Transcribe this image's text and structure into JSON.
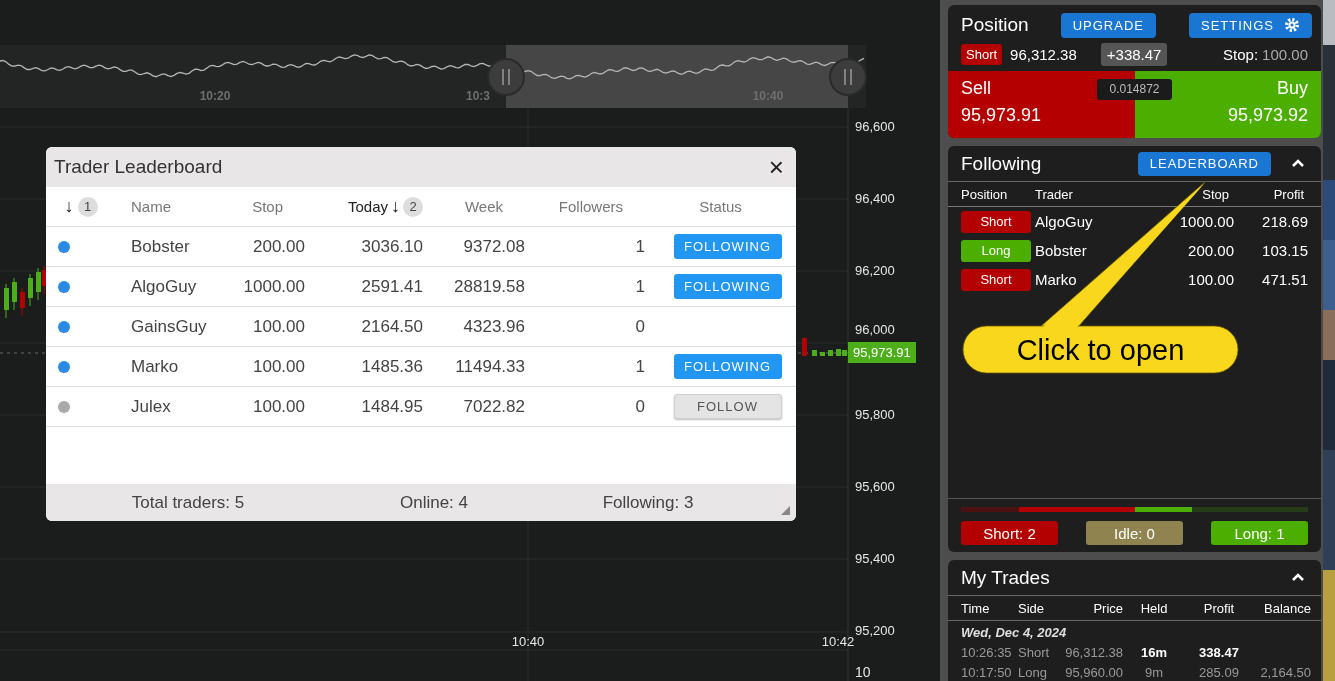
{
  "chart": {
    "navigator": {
      "time_labels": [
        "10:20",
        "10:3",
        "10:40"
      ]
    },
    "price_labels": [
      "96,600",
      "96,400",
      "96,200",
      "96,000",
      "95,800",
      "95,600",
      "95,400",
      "95,200",
      "10"
    ],
    "time_labels": [
      "10:40",
      "10:42"
    ],
    "current_price": "95,973.91"
  },
  "leaderboard": {
    "title": "Trader Leaderboard",
    "close": "×",
    "columns": [
      {
        "kind": "sort",
        "arrow": "↓",
        "badge": "1"
      },
      {
        "kind": "text",
        "label": "Name"
      },
      {
        "kind": "text",
        "label": "Stop"
      },
      {
        "kind": "sorted",
        "label": "Today",
        "arrow": "↓",
        "badge": "2"
      },
      {
        "kind": "text",
        "label": "Week"
      },
      {
        "kind": "text",
        "label": "Followers"
      },
      {
        "kind": "text",
        "label": "Status"
      }
    ],
    "rows": [
      {
        "color": "#2a8ae6",
        "name": "Bobster",
        "stop": "200.00",
        "today": "3036.10",
        "week": "9372.08",
        "followers": "1",
        "status": {
          "kind": "following",
          "label": "FOLLOWING"
        }
      },
      {
        "color": "#2a8ae6",
        "name": "AlgoGuy",
        "stop": "1000.00",
        "today": "2591.41",
        "week": "28819.58",
        "followers": "1",
        "status": {
          "kind": "following",
          "label": "FOLLOWING"
        }
      },
      {
        "color": "#2a8ae6",
        "name": "GainsGuy",
        "stop": "100.00",
        "today": "2164.50",
        "week": "4323.96",
        "followers": "0"
      },
      {
        "color": "#2a8ae6",
        "name": "Marko",
        "stop": "100.00",
        "today": "1485.36",
        "week": "11494.33",
        "followers": "1",
        "status": {
          "kind": "following",
          "label": "FOLLOWING"
        }
      },
      {
        "color": "#aaaaaa",
        "name": "Julex",
        "stop": "100.00",
        "today": "1484.95",
        "week": "7022.82",
        "followers": "0",
        "status": {
          "kind": "follow",
          "label": "FOLLOW"
        }
      }
    ],
    "footer": [
      "Total traders: 5",
      "Online: 4",
      "Following: 3"
    ]
  },
  "position": {
    "title": "Position",
    "buttons": [
      {
        "kind": "plain",
        "label": "UPGRADE"
      },
      {
        "kind": "settings",
        "label": "SETTINGS"
      }
    ],
    "side": {
      "kind": "short",
      "label": "Short"
    },
    "entry": "96,312.38",
    "pnl": "+338.47",
    "stop_label": "Stop:",
    "stop_value": "100.00",
    "sell": {
      "label": "Sell",
      "price": "95,973.91"
    },
    "spread": "0.014872",
    "buy": {
      "label": "Buy",
      "price": "95,973.92"
    }
  },
  "following": {
    "title": "Following",
    "button": "LEADERBOARD",
    "expanded": true,
    "columns": [
      "Position",
      "Trader",
      "Stop",
      "Profit"
    ],
    "rows": [
      {
        "kind": "short",
        "side": "Short",
        "trader": "AlgoGuy",
        "stop": "1000.00",
        "profit": "218.69"
      },
      {
        "kind": "long",
        "side": "Long",
        "trader": "Bobster",
        "stop": "200.00",
        "profit": "103.15"
      },
      {
        "kind": "short",
        "side": "Short",
        "trader": "Marko",
        "stop": "100.00",
        "profit": "471.51"
      }
    ],
    "bar": {
      "short": {
        "level": 0.667
      },
      "long": {
        "level": 0.333
      }
    },
    "counts": [
      {
        "kind": "short",
        "label": "Short: 2"
      },
      {
        "kind": "idle",
        "label": "Idle: 0"
      },
      {
        "kind": "long",
        "label": "Long: 1"
      }
    ]
  },
  "callout": {
    "text": "Click to open"
  },
  "trades": {
    "title": "My Trades",
    "expanded": true,
    "columns": [
      "Time",
      "Side",
      "Price",
      "Held",
      "Profit",
      "Balance"
    ],
    "date": "Wed, Dec 4, 2024",
    "rows": [
      {
        "open": true,
        "time": "10:26:35",
        "side": "Short",
        "price": "96,312.38",
        "held": "16m",
        "profit": "338.47"
      },
      {
        "open": false,
        "time": "10:17:50",
        "side": "Long",
        "price": "95,960.00",
        "held": "9m",
        "profit": "285.09",
        "balance": "2,164.50"
      }
    ]
  }
}
